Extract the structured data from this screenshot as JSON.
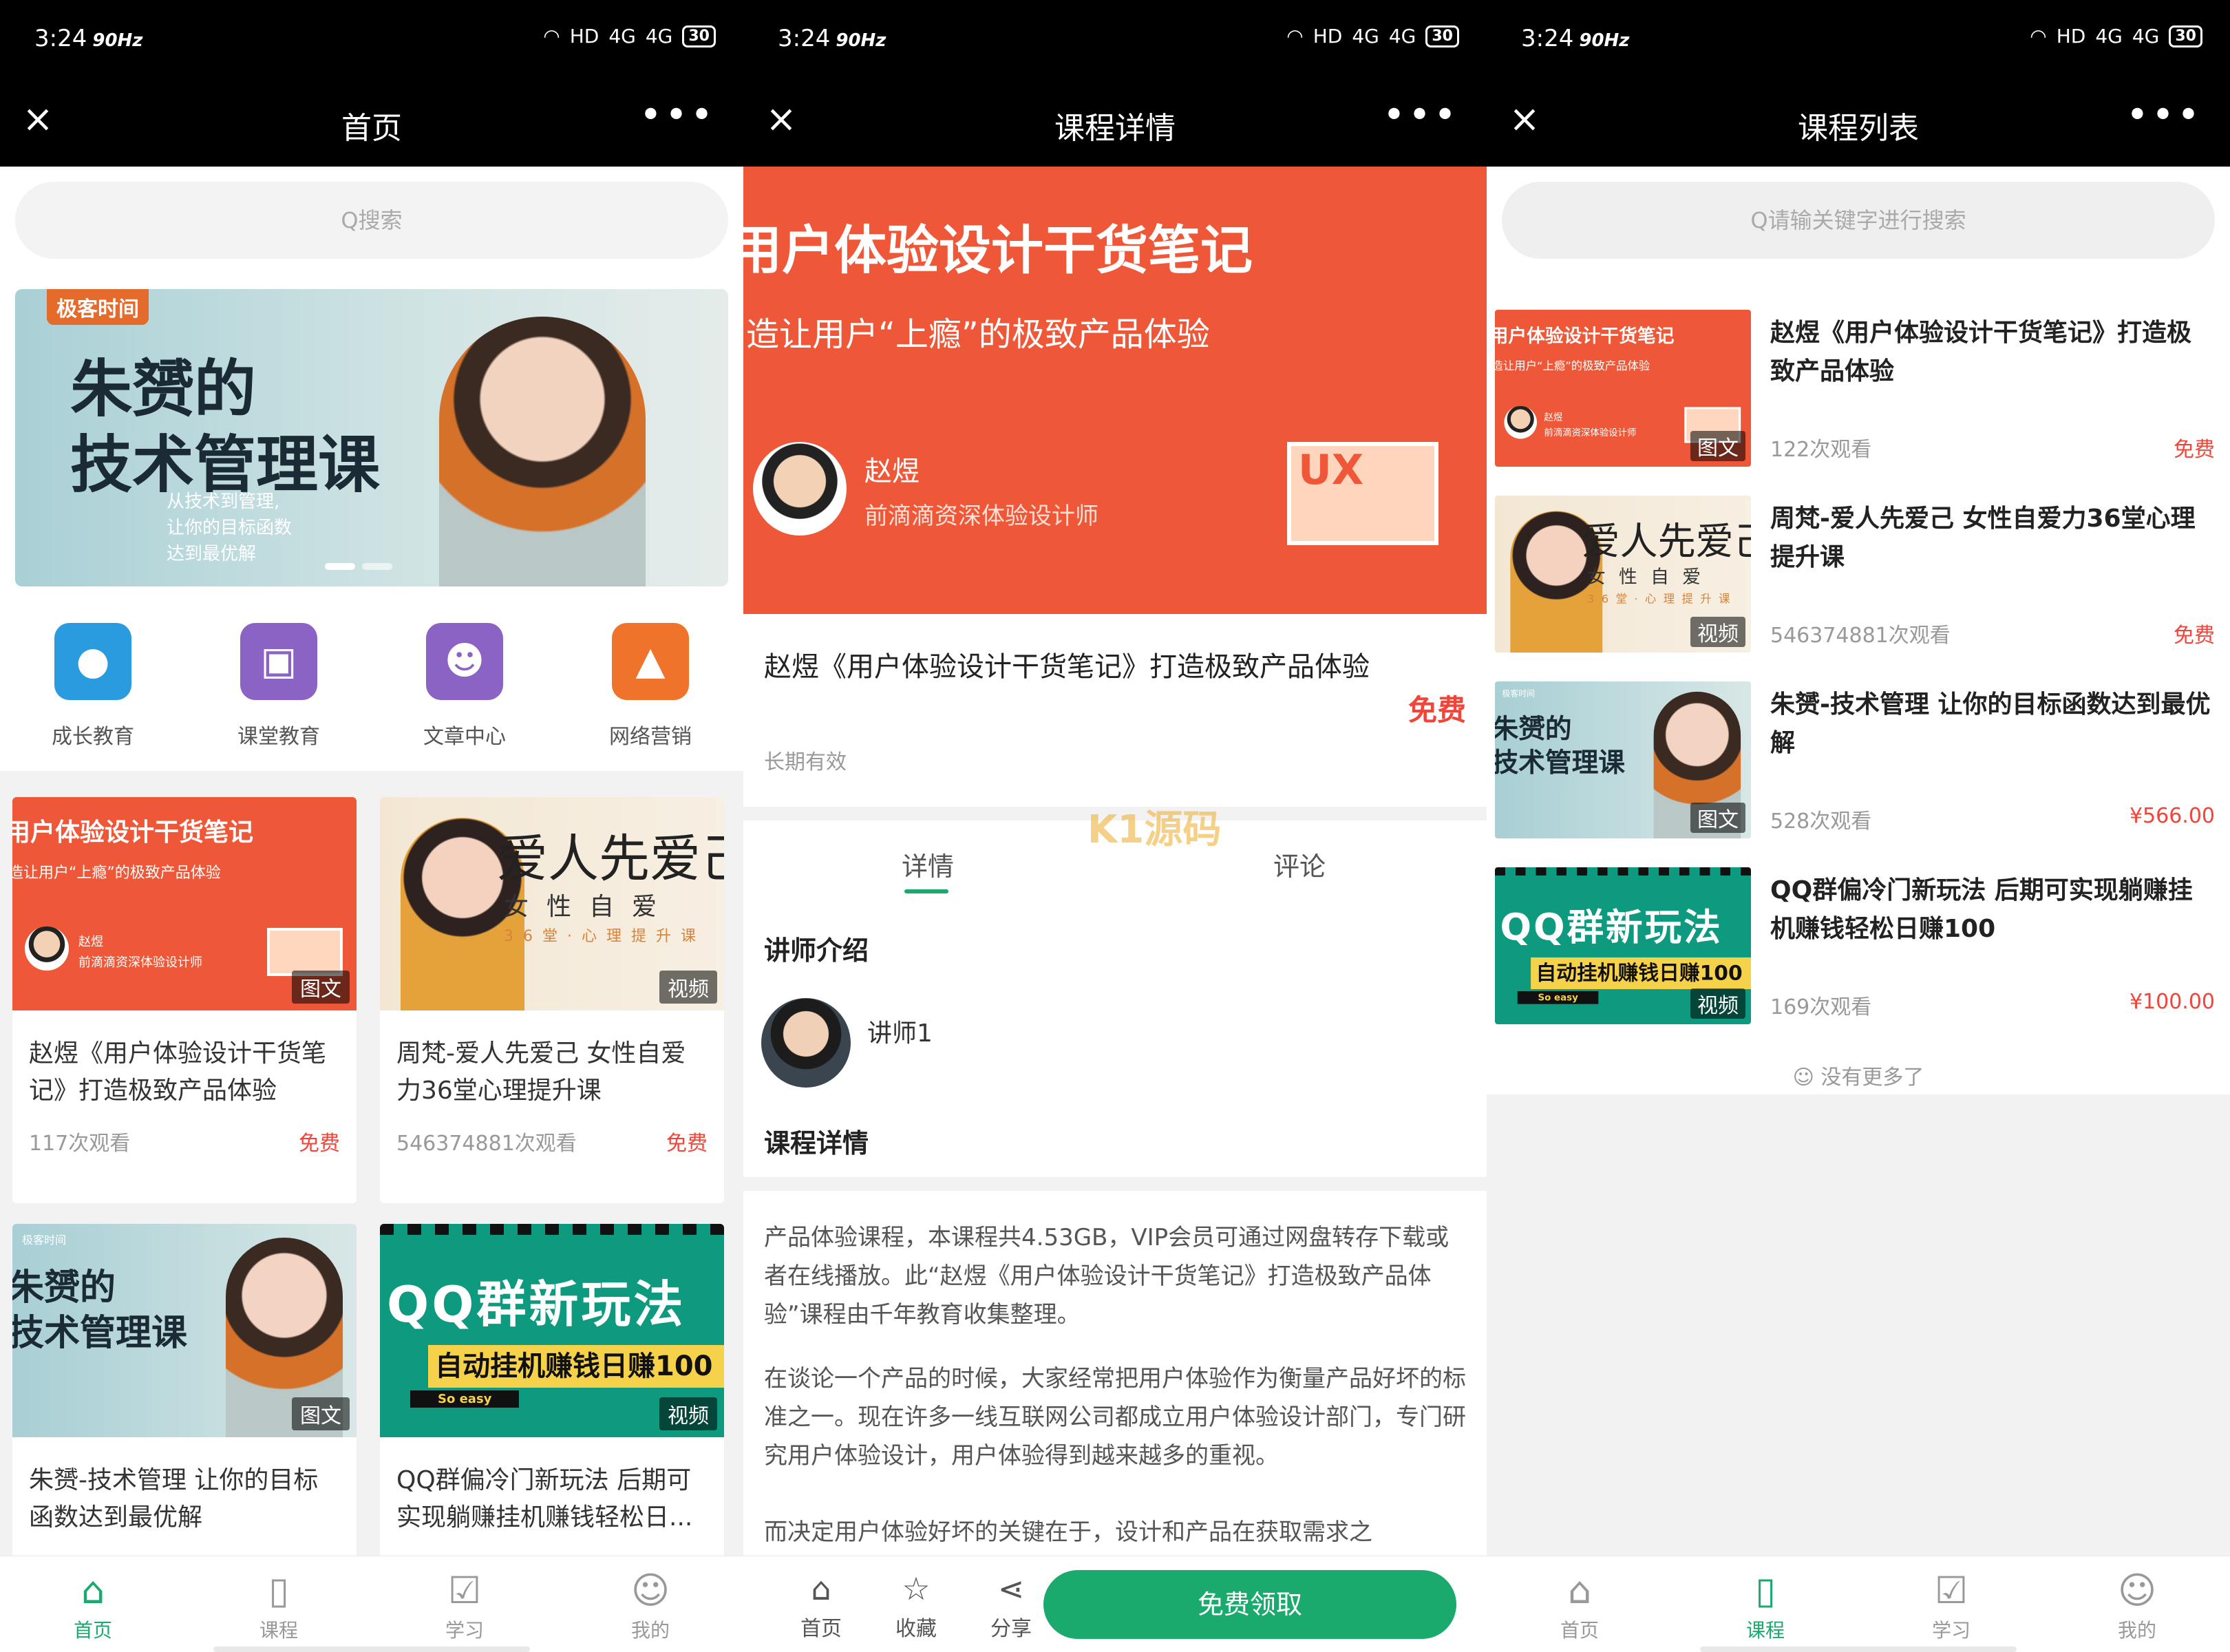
{
  "status": {
    "time": "3:24",
    "hz": "90Hz",
    "net": "HD",
    "sig1": "4G",
    "sig2": "4G",
    "battery": "30"
  },
  "panel1": {
    "title": "首页",
    "search_placeholder": "Q搜索",
    "banner": {
      "brand": "极客时间",
      "title_line1": "朱赟的",
      "title_line2": "技术管理课",
      "sub_line1": "从技术到管理,",
      "sub_line2": "让你的目标函数",
      "sub_line3": "达到最优解"
    },
    "categories": [
      {
        "label": "成长教育",
        "icon": "person-icon",
        "color": "#2b9be0"
      },
      {
        "label": "课堂教育",
        "icon": "briefcase-icon",
        "color": "#8a63c4"
      },
      {
        "label": "文章中心",
        "icon": "smiley-icon",
        "color": "#8a63c4"
      },
      {
        "label": "网络营销",
        "icon": "lock-icon",
        "color": "#f0732b"
      }
    ],
    "cards": [
      {
        "title": "赵煜《用户体验设计干货笔记》打造极致产品体验",
        "views": "117次观看",
        "price": "免费",
        "tag": "图文"
      },
      {
        "title": "周梵-爱人先爱己 女性自爱力36堂心理提升课",
        "views": "546374881次观看",
        "price": "免费",
        "tag": "视频"
      },
      {
        "title": "朱赟-技术管理 让你的目标函数达到最优解",
        "views": "",
        "price": "",
        "tag": "图文"
      },
      {
        "title": "QQ群偏冷门新玩法 后期可实现躺赚挂机赚钱轻松日...",
        "views": "",
        "price": "",
        "tag": "视频"
      }
    ],
    "tabs": [
      {
        "label": "首页",
        "icon": "home-icon",
        "active": true
      },
      {
        "label": "课程",
        "icon": "bookmark-icon",
        "active": false
      },
      {
        "label": "学习",
        "icon": "chart-icon",
        "active": false
      },
      {
        "label": "我的",
        "icon": "user-icon",
        "active": false
      }
    ]
  },
  "thumbs": {
    "ux": {
      "line1": "用户体验设计干货笔记",
      "line2": "造让用户“上瘾”的极致产品体验",
      "name": "赵煜",
      "role": "前滴滴资深体验设计师",
      "board": "UX"
    },
    "love": {
      "big": "爱人先爱己",
      "row": "女性自爱",
      "row2": "36堂·心理提升课"
    },
    "tech": {
      "brand": "极客时间",
      "line1": "朱赟的",
      "line2": "技术管理课"
    },
    "qq": {
      "big": "QQ群新玩法",
      "bar": "自动挂机赚钱日赚100",
      "easy": "So easy"
    }
  },
  "panel2": {
    "title": "课程详情",
    "hero": {
      "line1": "用户体验设计干货笔记",
      "line2": "造让用户“上瘾”的极致产品体验",
      "name": "赵煜",
      "role": "前滴滴资深体验设计师",
      "board": "UX"
    },
    "course_title": "赵煜《用户体验设计干货笔记》打造极致产品体验",
    "price": "免费",
    "validity": "长期有效",
    "tab_detail": "详情",
    "tab_comment": "评论",
    "watermark": "K1源码",
    "section_teacher": "讲师介绍",
    "teacher_name": "讲师1",
    "section_detail": "课程详情",
    "para1": "产品体验课程，本课程共4.53GB，VIP会员可通过网盘转存下载或者在线播放。此“赵煜《用户体验设计干货笔记》打造极致产品体验”课程由千年教育收集整理。",
    "para2": "在谈论一个产品的时候，大家经常把用户体验作为衡量产品好坏的标准之一。现在许多一线互联网公司都成立用户体验设计部门，专门研究用户体验设计，用户体验得到越来越多的重视。",
    "para3": "而决定用户体验好坏的关键在于，设计和产品在获取需求之",
    "actions": [
      {
        "label": "首页",
        "icon": "home-icon"
      },
      {
        "label": "收藏",
        "icon": "star-icon"
      },
      {
        "label": "分享",
        "icon": "share-icon"
      }
    ],
    "claim_label": "免费领取"
  },
  "panel3": {
    "title": "课程列表",
    "search_placeholder": "Q请输关键字进行搜索",
    "items": [
      {
        "title": "赵煜《用户体验设计干货笔记》打造极致产品体验",
        "views": "122次观看",
        "price": "免费",
        "tag": "图文"
      },
      {
        "title": "周梵-爱人先爱己 女性自爱力36堂心理提升课",
        "views": "546374881次观看",
        "price": "免费",
        "tag": "视频"
      },
      {
        "title": "朱赟-技术管理 让你的目标函数达到最优解",
        "views": "528次观看",
        "price": "¥566.00",
        "tag": "图文"
      },
      {
        "title": "QQ群偏冷门新玩法 后期可实现躺赚挂机赚钱轻松日赚100",
        "views": "169次观看",
        "price": "¥100.00",
        "tag": "视频"
      }
    ],
    "no_more": "☺ 没有更多了",
    "tabs": [
      {
        "label": "首页",
        "icon": "home-icon",
        "active": false
      },
      {
        "label": "课程",
        "icon": "bookmark-icon",
        "active": true
      },
      {
        "label": "学习",
        "icon": "chart-icon",
        "active": false
      },
      {
        "label": "我的",
        "icon": "user-icon",
        "active": false
      }
    ]
  },
  "colors": {
    "accent": "#1aaa6e",
    "price": "#f2453a",
    "hero": "#ee5838"
  }
}
